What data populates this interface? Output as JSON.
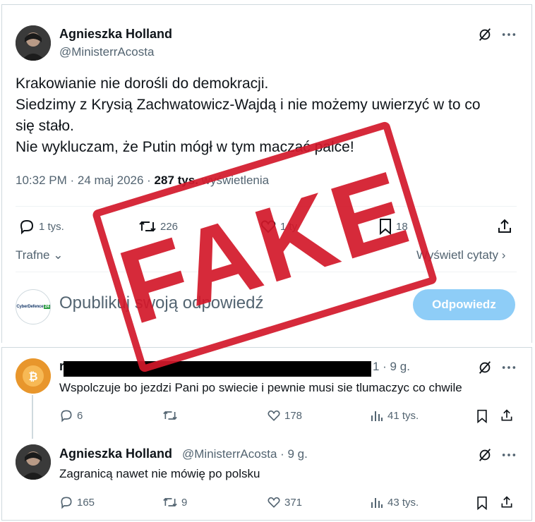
{
  "main_tweet": {
    "author_name": "Agnieszka Holland",
    "author_handle": "@MinisterrAcosta",
    "lines": [
      "Krakowianie nie dorośli do demokracji.",
      "Siedzimy z Krysią Zachwatowicz-Wajdą i nie możemy uwierzyć w to co",
      "się stało.",
      "Nie wykluczam, że Putin mógł w tym maczać palce!"
    ],
    "time": "10:32 PM · 24 maj 2026 · ",
    "views_count": "287 tys.",
    "views_label": " wyświetlenia",
    "actions": {
      "replies": "1 tys.",
      "reposts": "226",
      "likes": "1 ty",
      "bookmarks": "18"
    },
    "icons": [
      "grok-icon",
      "more-icon",
      "reply-icon",
      "repost-icon",
      "like-icon",
      "bookmark-icon",
      "share-icon"
    ]
  },
  "sort": {
    "label": "Trafne",
    "quotes_label": "Wyświetl cytaty"
  },
  "composer": {
    "logo_text": "CyberDefence",
    "logo_badge": "24",
    "placeholder": "Opublikuj swoją odpowiedź",
    "submit_label": "Odpowiedz"
  },
  "replies": [
    {
      "name_initial": "r",
      "meta": "1 · 9 g.",
      "text": "Wspolczuje bo jezdzi Pani po swiecie i pewnie musi sie tlumaczyc co chwile",
      "replies": "6",
      "reposts": "",
      "likes": "178",
      "views": "41 tys."
    },
    {
      "author_name": "Agnieszka Holland",
      "author_handle": "@MinisterrAcosta · 9 g.",
      "text": "Zagranicą nawet nie mówię po polsku",
      "replies": "165",
      "reposts": "9",
      "likes": "371",
      "views": "43 tys."
    }
  ],
  "stamp": {
    "text": "FAKE",
    "color": "#d3182a"
  },
  "colors": {
    "text": "#0f1419",
    "muted": "#536471",
    "button_disabled": "#8ecdf7",
    "border": "#cfd9de"
  }
}
